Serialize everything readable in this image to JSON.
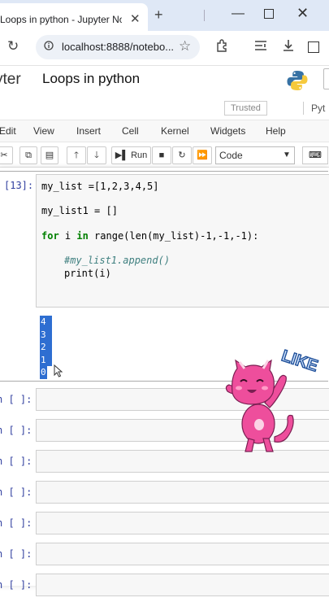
{
  "browser": {
    "tab_title": "Loops in python - Jupyter Note",
    "url": "localhost:8888/notebo...",
    "icons": [
      "close-icon",
      "plus-icon",
      "minimize-icon",
      "maximize-icon",
      "reload-icon",
      "site-info-icon",
      "star-icon",
      "extensions-icon",
      "side-panel-icon",
      "download-icon",
      "split-view-icon"
    ]
  },
  "jupyter": {
    "logo_text": "yter",
    "notebook_title": "Loops in python",
    "trusted_label": "Trusted",
    "kernel_label": "Pyt",
    "menu": [
      "Edit",
      "View",
      "Insert",
      "Cell",
      "Kernel",
      "Widgets",
      "Help"
    ],
    "toolbar": {
      "run_label": "Run",
      "cell_type": "Code"
    }
  },
  "cell": {
    "prompt": "[13]:",
    "code_lines": {
      "l1": "my_list =[1,2,3,4,5]",
      "l2": "my_list1 = []",
      "l3a": "for",
      "l3b": " i ",
      "l3c": "in",
      "l3d": " range(len(my_list)-1,-1,-1):",
      "l4": "#my_list1.append()",
      "l5": "print(i)"
    },
    "output": [
      "4",
      "3",
      "2",
      "1",
      "0"
    ]
  },
  "empty_cells": [
    {
      "prompt": "n [ ]:"
    },
    {
      "prompt": "n [ ]:"
    },
    {
      "prompt": "n [ ]:"
    },
    {
      "prompt": "n [ ]:"
    },
    {
      "prompt": "n [ ]:"
    },
    {
      "prompt": "n [ ]:"
    },
    {
      "prompt": "n [ ]:"
    }
  ],
  "sticker": {
    "text": "LIKE"
  },
  "colors": {
    "accent": "#303f9f",
    "selection": "#2e6ed1",
    "sticker_pink": "#ee4e9c"
  }
}
